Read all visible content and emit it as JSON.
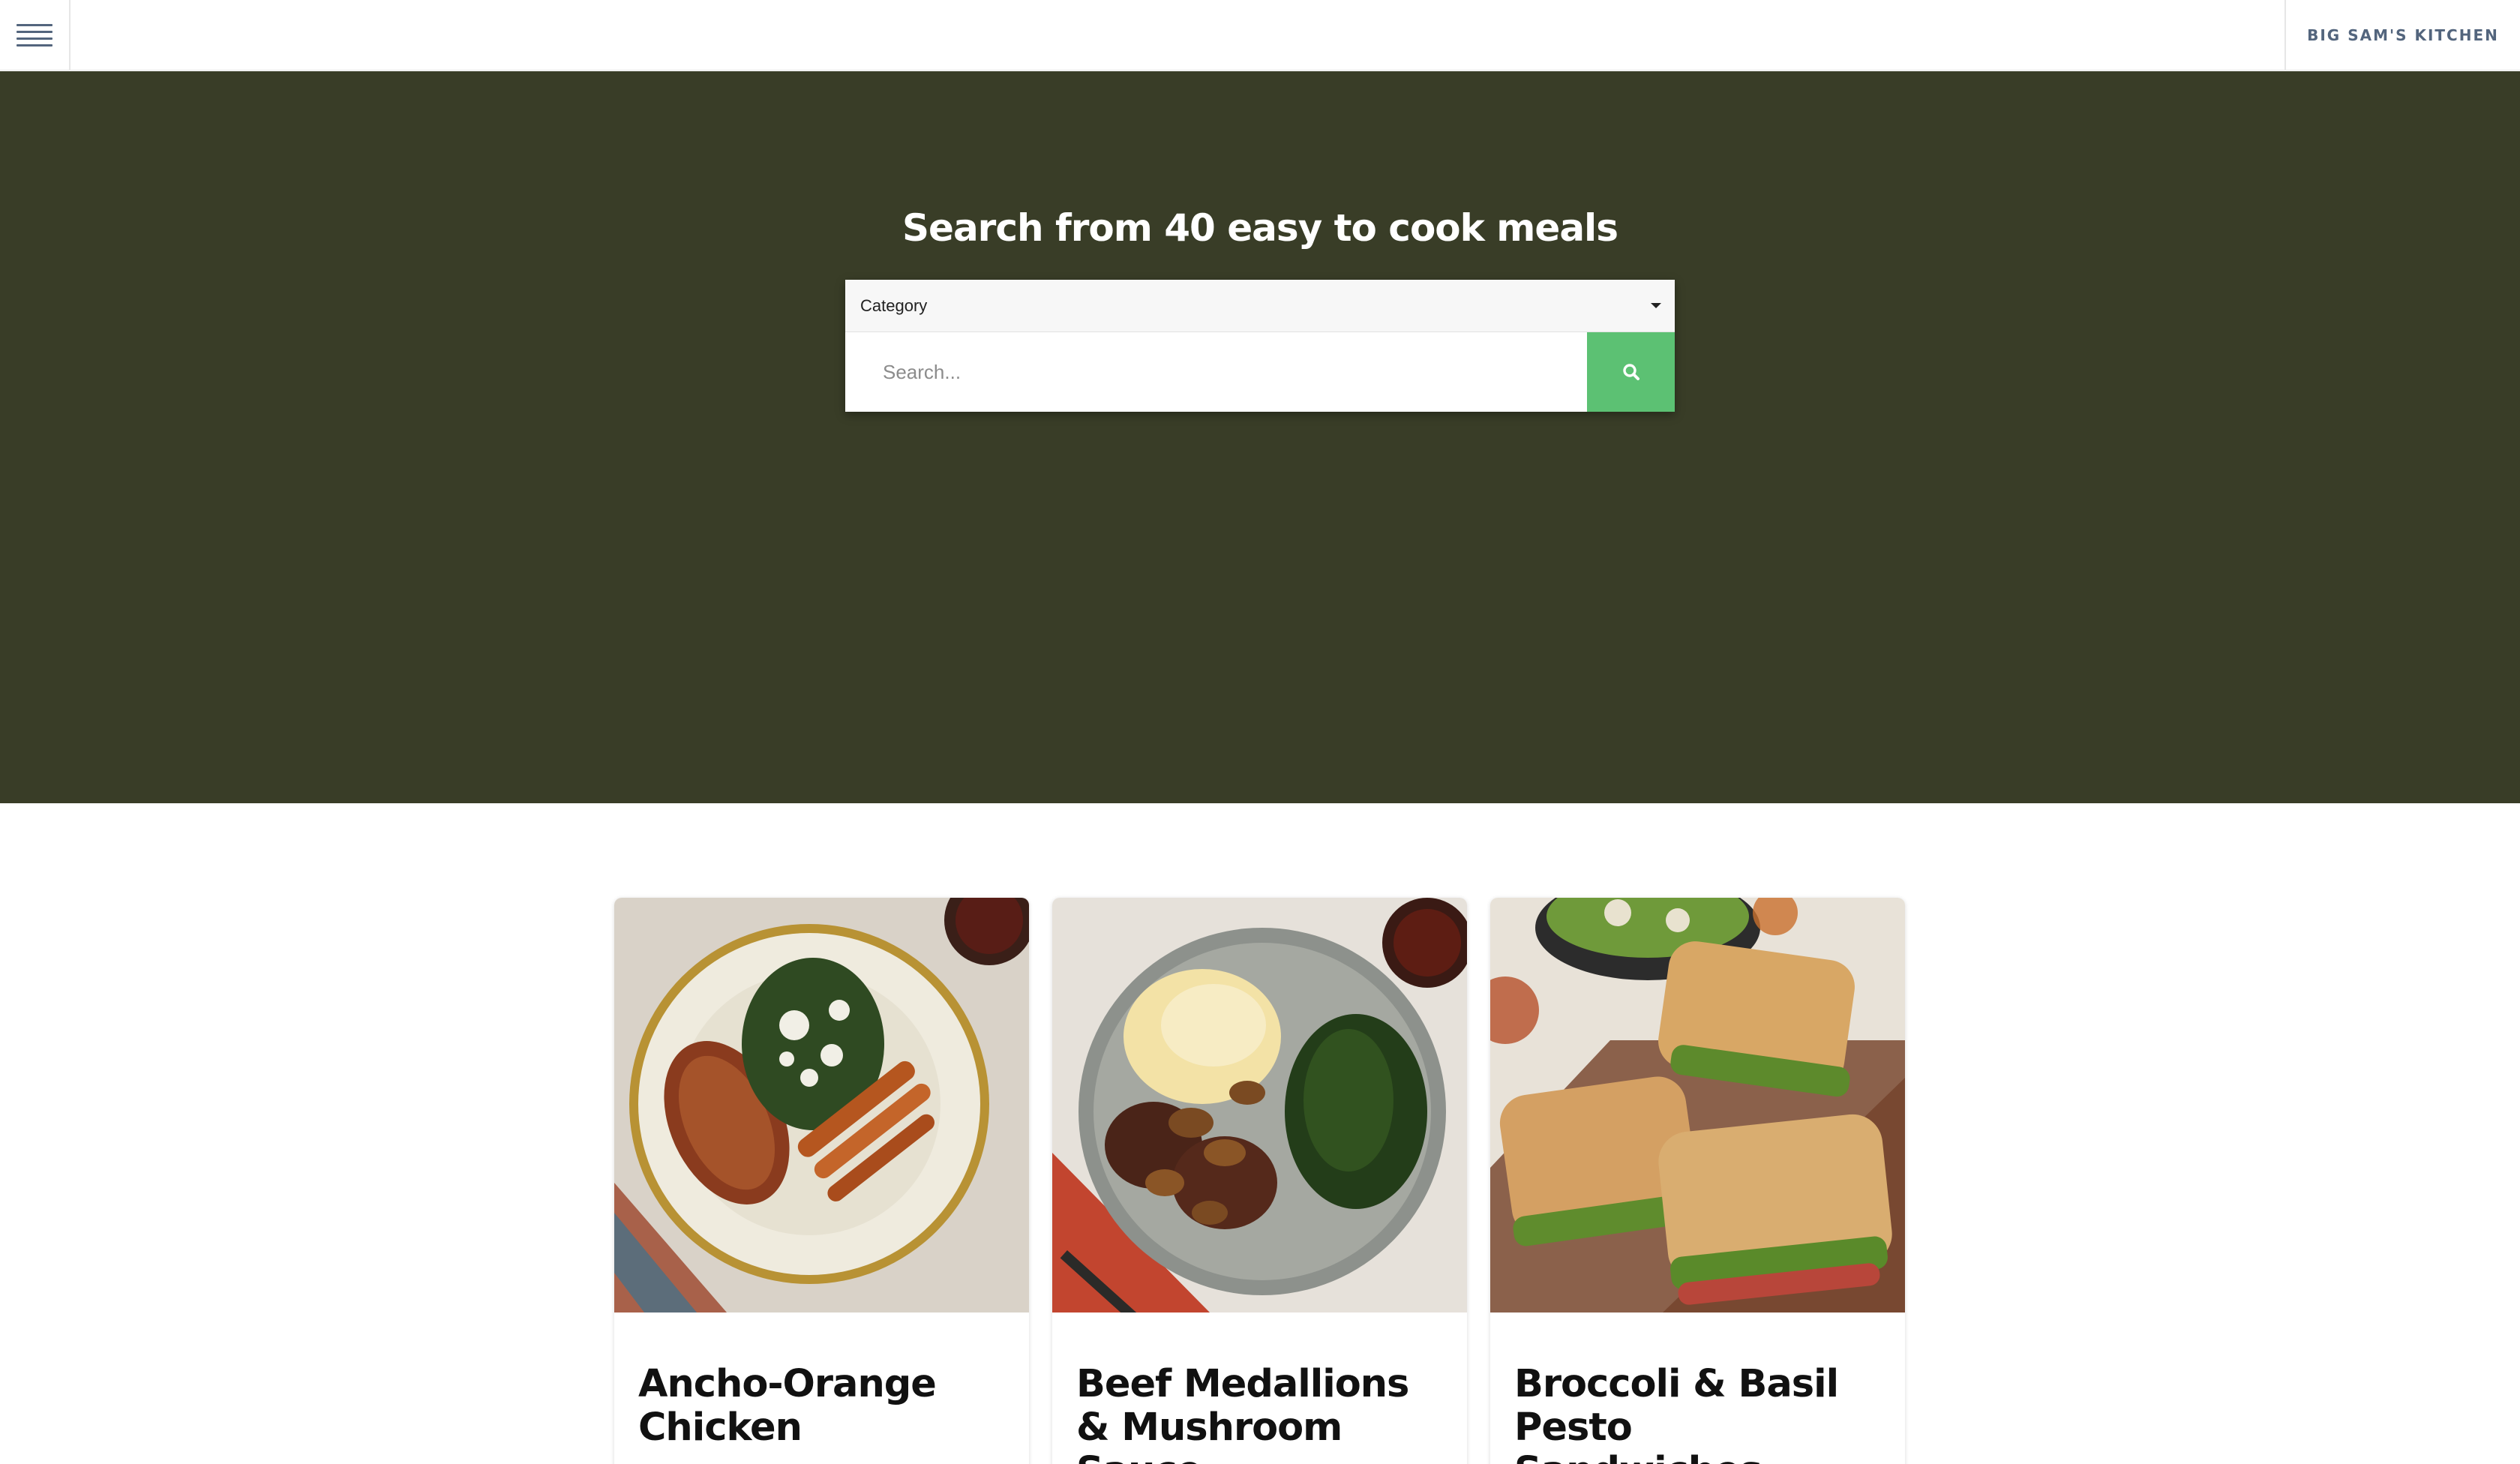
{
  "header": {
    "menu_icon": "hamburger-menu-icon",
    "brand": "BIG SAM'S KITCHEN"
  },
  "hero": {
    "title": "Search from 40 easy to cook meals",
    "category": {
      "selected": "Category"
    },
    "search": {
      "placeholder": "Search...",
      "value": "",
      "button_icon": "search-icon"
    }
  },
  "colors": {
    "hero_bg": "#393d27",
    "search_button": "#5cc173",
    "brand_text": "#53657d"
  },
  "recipes": [
    {
      "title": "Ancho-Orange Chicken",
      "image": "chicken-plate-photo"
    },
    {
      "title": "Beef Medallions & Mushroom Sauce",
      "image": "beef-plate-photo"
    },
    {
      "title": "Broccoli & Basil Pesto Sandwiches",
      "image": "sandwich-photo"
    }
  ]
}
